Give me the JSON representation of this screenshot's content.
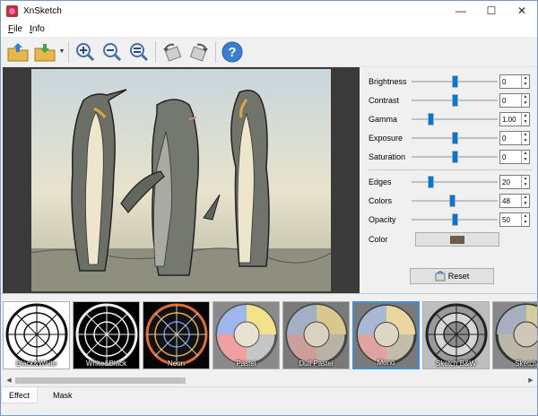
{
  "window": {
    "title": "XnSketch"
  },
  "menu": [
    {
      "label": "File",
      "hotkey": "F",
      "rest": "ile"
    },
    {
      "label": "Info",
      "hotkey": "I",
      "rest": "nfo"
    }
  ],
  "toolbar": {
    "buttons": [
      {
        "name": "open-icon"
      },
      {
        "name": "save-icon"
      },
      {
        "name": "zoom-in-icon"
      },
      {
        "name": "zoom-out-icon"
      },
      {
        "name": "zoom-fit-icon"
      },
      {
        "name": "rotate-left-icon"
      },
      {
        "name": "rotate-right-icon"
      },
      {
        "name": "help-icon"
      }
    ]
  },
  "adjustments": {
    "brightness": {
      "label": "Brightness",
      "value": "0",
      "level": 0.5
    },
    "contrast": {
      "label": "Contrast",
      "value": "0",
      "level": 0.5
    },
    "gamma": {
      "label": "Gamma",
      "value": "1.00",
      "level": 0.2
    },
    "exposure": {
      "label": "Exposure",
      "value": "0",
      "level": 0.5
    },
    "saturation": {
      "label": "Saturation",
      "value": "0",
      "level": 0.5
    }
  },
  "sketch": {
    "edges": {
      "label": "Edges",
      "value": "20",
      "level": 0.2
    },
    "colors": {
      "label": "Colors",
      "value": "48",
      "level": 0.47
    },
    "opacity": {
      "label": "Opacity",
      "value": "50",
      "level": 0.5
    },
    "color": {
      "label": "Color",
      "swatch": "#6b5e48"
    }
  },
  "reset_label": "Reset",
  "effects": [
    {
      "label": "Black&White"
    },
    {
      "label": "White&Black"
    },
    {
      "label": "Neon"
    },
    {
      "label": "Pastel"
    },
    {
      "label": "Dull Pastel"
    },
    {
      "label": "Mono",
      "selected": true
    },
    {
      "label": "Sketch B&W"
    },
    {
      "label": "Sketch"
    }
  ],
  "tabs": [
    {
      "label": "Effect",
      "active": true
    },
    {
      "label": "Mask",
      "active": false
    }
  ],
  "colors": {
    "accent": "#0078d7",
    "selected_border": "#3c8fd8",
    "preview_bg": "#3a3a3a"
  }
}
